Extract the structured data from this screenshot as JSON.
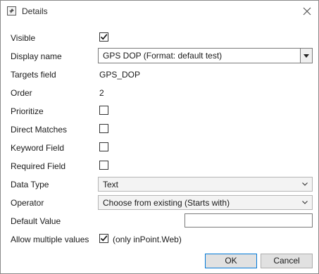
{
  "window": {
    "title": "Details"
  },
  "fields": {
    "visible": {
      "label": "Visible",
      "checked": true
    },
    "display_name": {
      "label": "Display name",
      "value": "GPS DOP (Format: default test)"
    },
    "targets_field": {
      "label": "Targets field",
      "value": "GPS_DOP"
    },
    "order": {
      "label": "Order",
      "value": "2"
    },
    "prioritize": {
      "label": "Prioritize",
      "checked": false
    },
    "direct_matches": {
      "label": "Direct Matches",
      "checked": false
    },
    "keyword_field": {
      "label": "Keyword Field",
      "checked": false
    },
    "required_field": {
      "label": "Required Field",
      "checked": false
    },
    "data_type": {
      "label": "Data Type",
      "value": "Text"
    },
    "operator": {
      "label": "Operator",
      "value": "Choose from existing (Starts with)"
    },
    "default_value": {
      "label": "Default Value",
      "value": ""
    },
    "allow_multiple": {
      "label": "Allow multiple values",
      "checked": true,
      "note": "(only inPoint.Web)"
    }
  },
  "buttons": {
    "ok": "OK",
    "cancel": "Cancel"
  },
  "icons": {
    "app": "window-pin-icon",
    "close": "close-icon",
    "dropdown": "chevron-down-icon",
    "check": "checkmark-icon"
  },
  "colors": {
    "ok_border": "#0078d7",
    "button_bg": "#e1e1e1"
  }
}
